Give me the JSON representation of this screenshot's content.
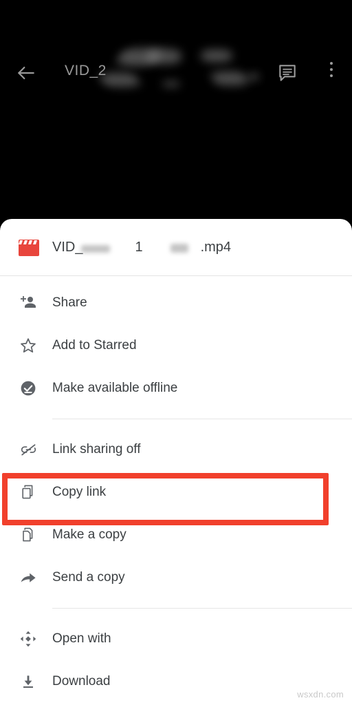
{
  "viewer": {
    "title": "VID_2",
    "back_icon": "back-arrow-icon",
    "comment_icon": "comment-icon",
    "overflow_icon": "more-vertical-icon"
  },
  "file": {
    "icon": "video-clapperboard-icon",
    "name_prefix": "VID_",
    "name_middle": "1",
    "name_suffix": ".mp4",
    "icon_color": "#e8453c"
  },
  "menu": {
    "items": [
      {
        "id": "share",
        "label": "Share",
        "icon": "person-add-icon"
      },
      {
        "id": "add-to-starred",
        "label": "Add to Starred",
        "icon": "star-outline-icon"
      },
      {
        "id": "offline",
        "label": "Make available offline",
        "icon": "check-circle-icon"
      },
      {
        "id": "link-sharing",
        "label": "Link sharing off",
        "icon": "link-off-icon"
      },
      {
        "id": "copy-link",
        "label": "Copy link",
        "icon": "copy-icon"
      },
      {
        "id": "make-a-copy",
        "label": "Make a copy",
        "icon": "file-copy-icon"
      },
      {
        "id": "send-a-copy",
        "label": "Send a copy",
        "icon": "share-arrow-icon"
      },
      {
        "id": "open-with",
        "label": "Open with",
        "icon": "open-with-icon"
      },
      {
        "id": "download",
        "label": "Download",
        "icon": "download-icon"
      }
    ]
  },
  "annotation": {
    "target": "Copy link",
    "color": "#f1402c"
  },
  "watermark": {
    "text": "wsxdn.com"
  }
}
